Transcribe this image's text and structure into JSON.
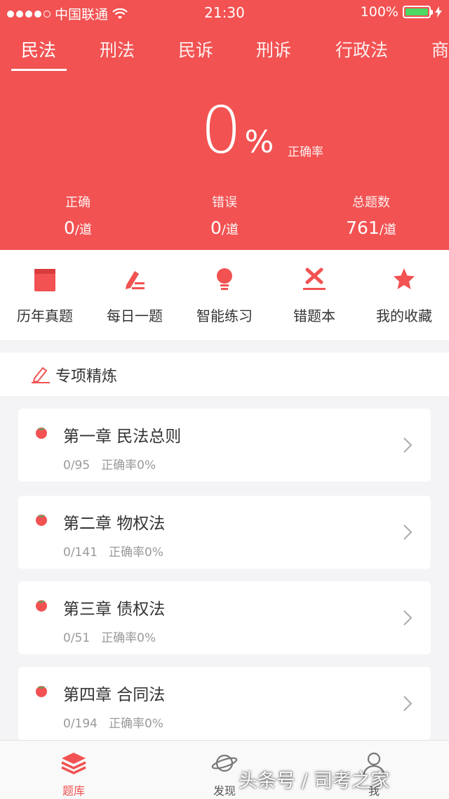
{
  "status_bar": {
    "carrier": "中国联通",
    "time": "21:30",
    "battery": "100%"
  },
  "subject_tabs": [
    "民法",
    "刑法",
    "民诉",
    "刑诉",
    "行政法",
    "商"
  ],
  "summary": {
    "accuracy_value": "0",
    "accuracy_unit": "%",
    "accuracy_label": "正确率",
    "correct_label": "正确",
    "correct_value": "0",
    "correct_unit": "/道",
    "wrong_label": "错误",
    "wrong_value": "0",
    "wrong_unit": "/道",
    "total_label": "总题数",
    "total_value": "761",
    "total_unit": "/道"
  },
  "quick_actions": [
    {
      "label": "历年真题",
      "icon": "book-icon"
    },
    {
      "label": "每日一题",
      "icon": "pen-write-icon"
    },
    {
      "label": "智能练习",
      "icon": "lightbulb-icon"
    },
    {
      "label": "错题本",
      "icon": "cross-icon"
    },
    {
      "label": "我的收藏",
      "icon": "star-icon"
    }
  ],
  "section": {
    "title": "专项精炼",
    "icon": "pencil-icon"
  },
  "chapters": [
    {
      "title": "第一章 民法总则",
      "progress": "0/95",
      "accuracy": "正确率0%"
    },
    {
      "title": "第二章 物权法",
      "progress": "0/141",
      "accuracy": "正确率0%"
    },
    {
      "title": "第三章 债权法",
      "progress": "0/51",
      "accuracy": "正确率0%"
    },
    {
      "title": "第四章 合同法",
      "progress": "0/194",
      "accuracy": "正确率0%"
    }
  ],
  "bottom_nav": [
    {
      "label": "题库",
      "icon": "layers-icon",
      "active": true
    },
    {
      "label": "发现",
      "icon": "planet-icon",
      "active": false
    },
    {
      "label": "我",
      "icon": "person-icon",
      "active": false
    }
  ],
  "watermark": "头条号 / 司考之家",
  "colors": {
    "primary": "#f25252",
    "battery_fill": "#4cd964"
  }
}
